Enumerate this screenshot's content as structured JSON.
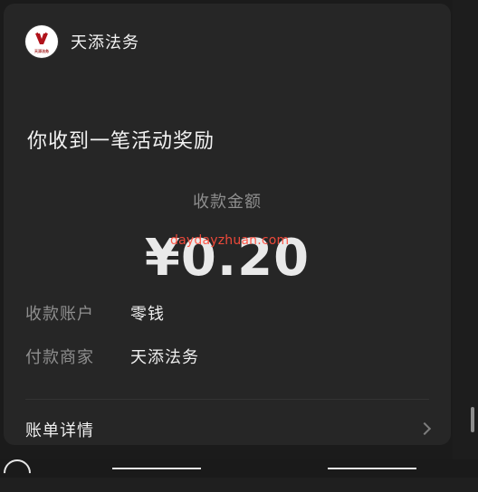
{
  "merchant": {
    "name": "天添法务",
    "logo_tagline": "天添法务"
  },
  "headline": "你收到一笔活动奖励",
  "amount": {
    "label": "收款金额",
    "value": "¥0.20"
  },
  "watermark": "daydayzhuan.com",
  "rows": [
    {
      "label": "收款账户",
      "value": "零钱"
    },
    {
      "label": "付款商家",
      "value": "天添法务"
    }
  ],
  "detail_link": {
    "label": "账单详情",
    "icon": "chevron-right-icon"
  },
  "colors": {
    "background": "#1f1f1f",
    "card": "#262626",
    "label_gray": "#8f8f8f",
    "text_white": "#efefef",
    "watermark_red": "#ff4c3c",
    "logo_red": "#b0121b"
  }
}
